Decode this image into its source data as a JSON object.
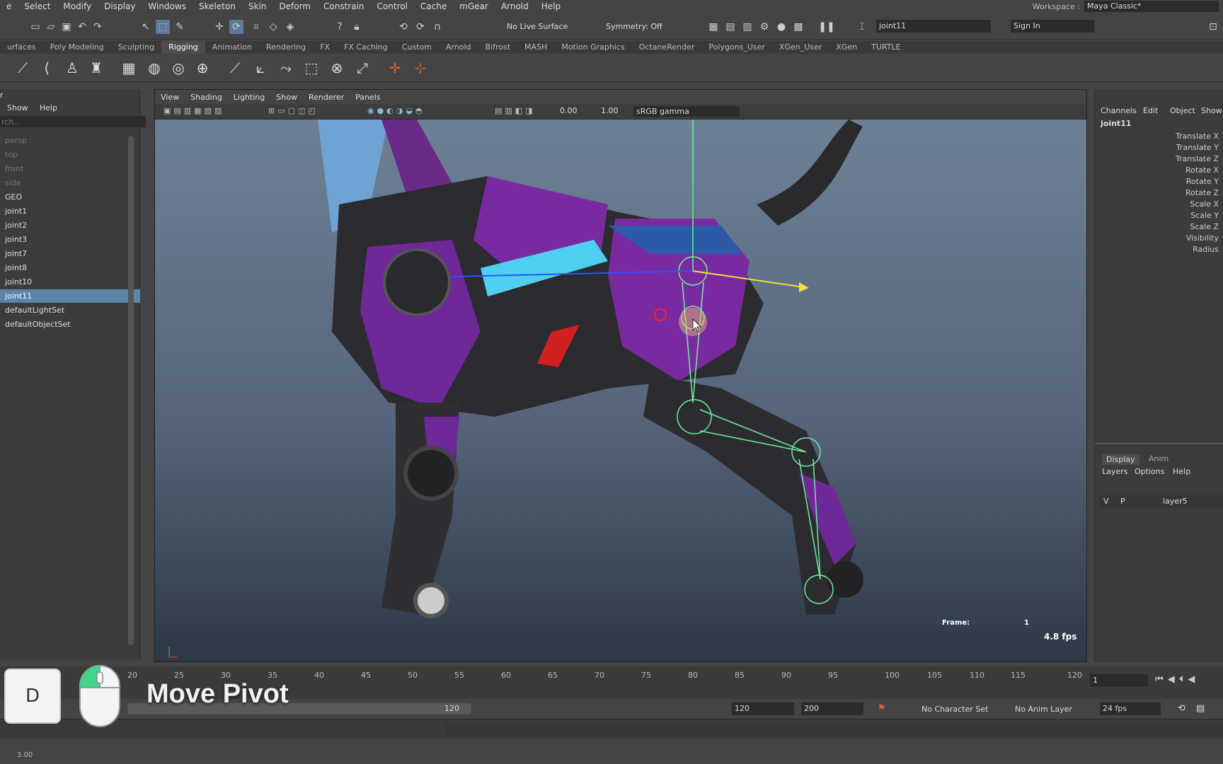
{
  "menubar": {
    "items": [
      "e",
      "Select",
      "Modify",
      "Display",
      "Windows",
      "Skeleton",
      "Skin",
      "Deform",
      "Constrain",
      "Control",
      "Cache",
      "mGear",
      "Arnold",
      "Help"
    ],
    "workspace_label": "Workspace :",
    "workspace_value": "Maya Classic*"
  },
  "statusline": {
    "live_surface": "No Live Surface",
    "symmetry": "Symmetry: Off",
    "selected_object": "joint11",
    "sign_in": "Sign In"
  },
  "shelf": {
    "tabs": [
      "urfaces",
      "Poly Modeling",
      "Sculpting",
      "Rigging",
      "Animation",
      "Rendering",
      "FX",
      "FX Caching",
      "Custom",
      "Arnold",
      "Bifrost",
      "MASH",
      "Motion Graphics",
      "OctaneRender",
      "Polygons_User",
      "XGen_User",
      "XGen",
      "TURTLE"
    ],
    "active_tab": "Rigging"
  },
  "outliner": {
    "title": "r",
    "menu": [
      "Show",
      "Help"
    ],
    "search_placeholder": "rch...",
    "items": [
      {
        "label": "persp",
        "dim": true
      },
      {
        "label": "top",
        "dim": true
      },
      {
        "label": "front",
        "dim": true
      },
      {
        "label": "side",
        "dim": true
      },
      {
        "label": "GEO",
        "dim": false
      },
      {
        "label": "joint1",
        "dim": false
      },
      {
        "label": "joint2",
        "dim": false
      },
      {
        "label": "joint3",
        "dim": false
      },
      {
        "label": "joint7",
        "dim": false
      },
      {
        "label": "joint8",
        "dim": false
      },
      {
        "label": "joint10",
        "dim": false
      },
      {
        "label": "joint11",
        "dim": false,
        "selected": true
      },
      {
        "label": "defaultLightSet",
        "dim": false
      },
      {
        "label": "defaultObjectSet",
        "dim": false
      }
    ]
  },
  "viewport": {
    "menu": [
      "View",
      "Shading",
      "Lighting",
      "Show",
      "Renderer",
      "Panels"
    ],
    "exposure": "0.00",
    "gamma": "1.00",
    "color_space": "sRGB gamma",
    "frame_label": "Frame:",
    "frame_value": "1",
    "fps": "4.8 fps"
  },
  "channelbox": {
    "menu": [
      "Channels",
      "Edit",
      "Object",
      "Show"
    ],
    "object": "joint11",
    "attributes": [
      "Translate X",
      "Translate Y",
      "Translate Z",
      "Rotate X",
      "Rotate Y",
      "Rotate Z",
      "Scale X",
      "Scale Y",
      "Scale Z",
      "Visibility",
      "Radius"
    ],
    "layer_tabs": [
      "Display",
      "Anim"
    ],
    "layer_menu": [
      "Layers",
      "Options",
      "Help"
    ],
    "layer": {
      "v": "V",
      "p": "P",
      "name": "layer5"
    }
  },
  "timeline": {
    "ticks": [
      "20",
      "25",
      "30",
      "35",
      "40",
      "45",
      "50",
      "55",
      "60",
      "65",
      "70",
      "75",
      "80",
      "85",
      "90",
      "95",
      "100",
      "105",
      "110",
      "115",
      "120"
    ],
    "current_frame": "1",
    "range_end": "120",
    "anim_start": "120",
    "anim_end": "200",
    "character_set": "No Character Set",
    "anim_layer": "No Anim Layer",
    "fps": "24 fps"
  },
  "helpline": {
    "value": "3.00"
  },
  "overlay": {
    "key": "D",
    "caption": "Move Pivot"
  }
}
